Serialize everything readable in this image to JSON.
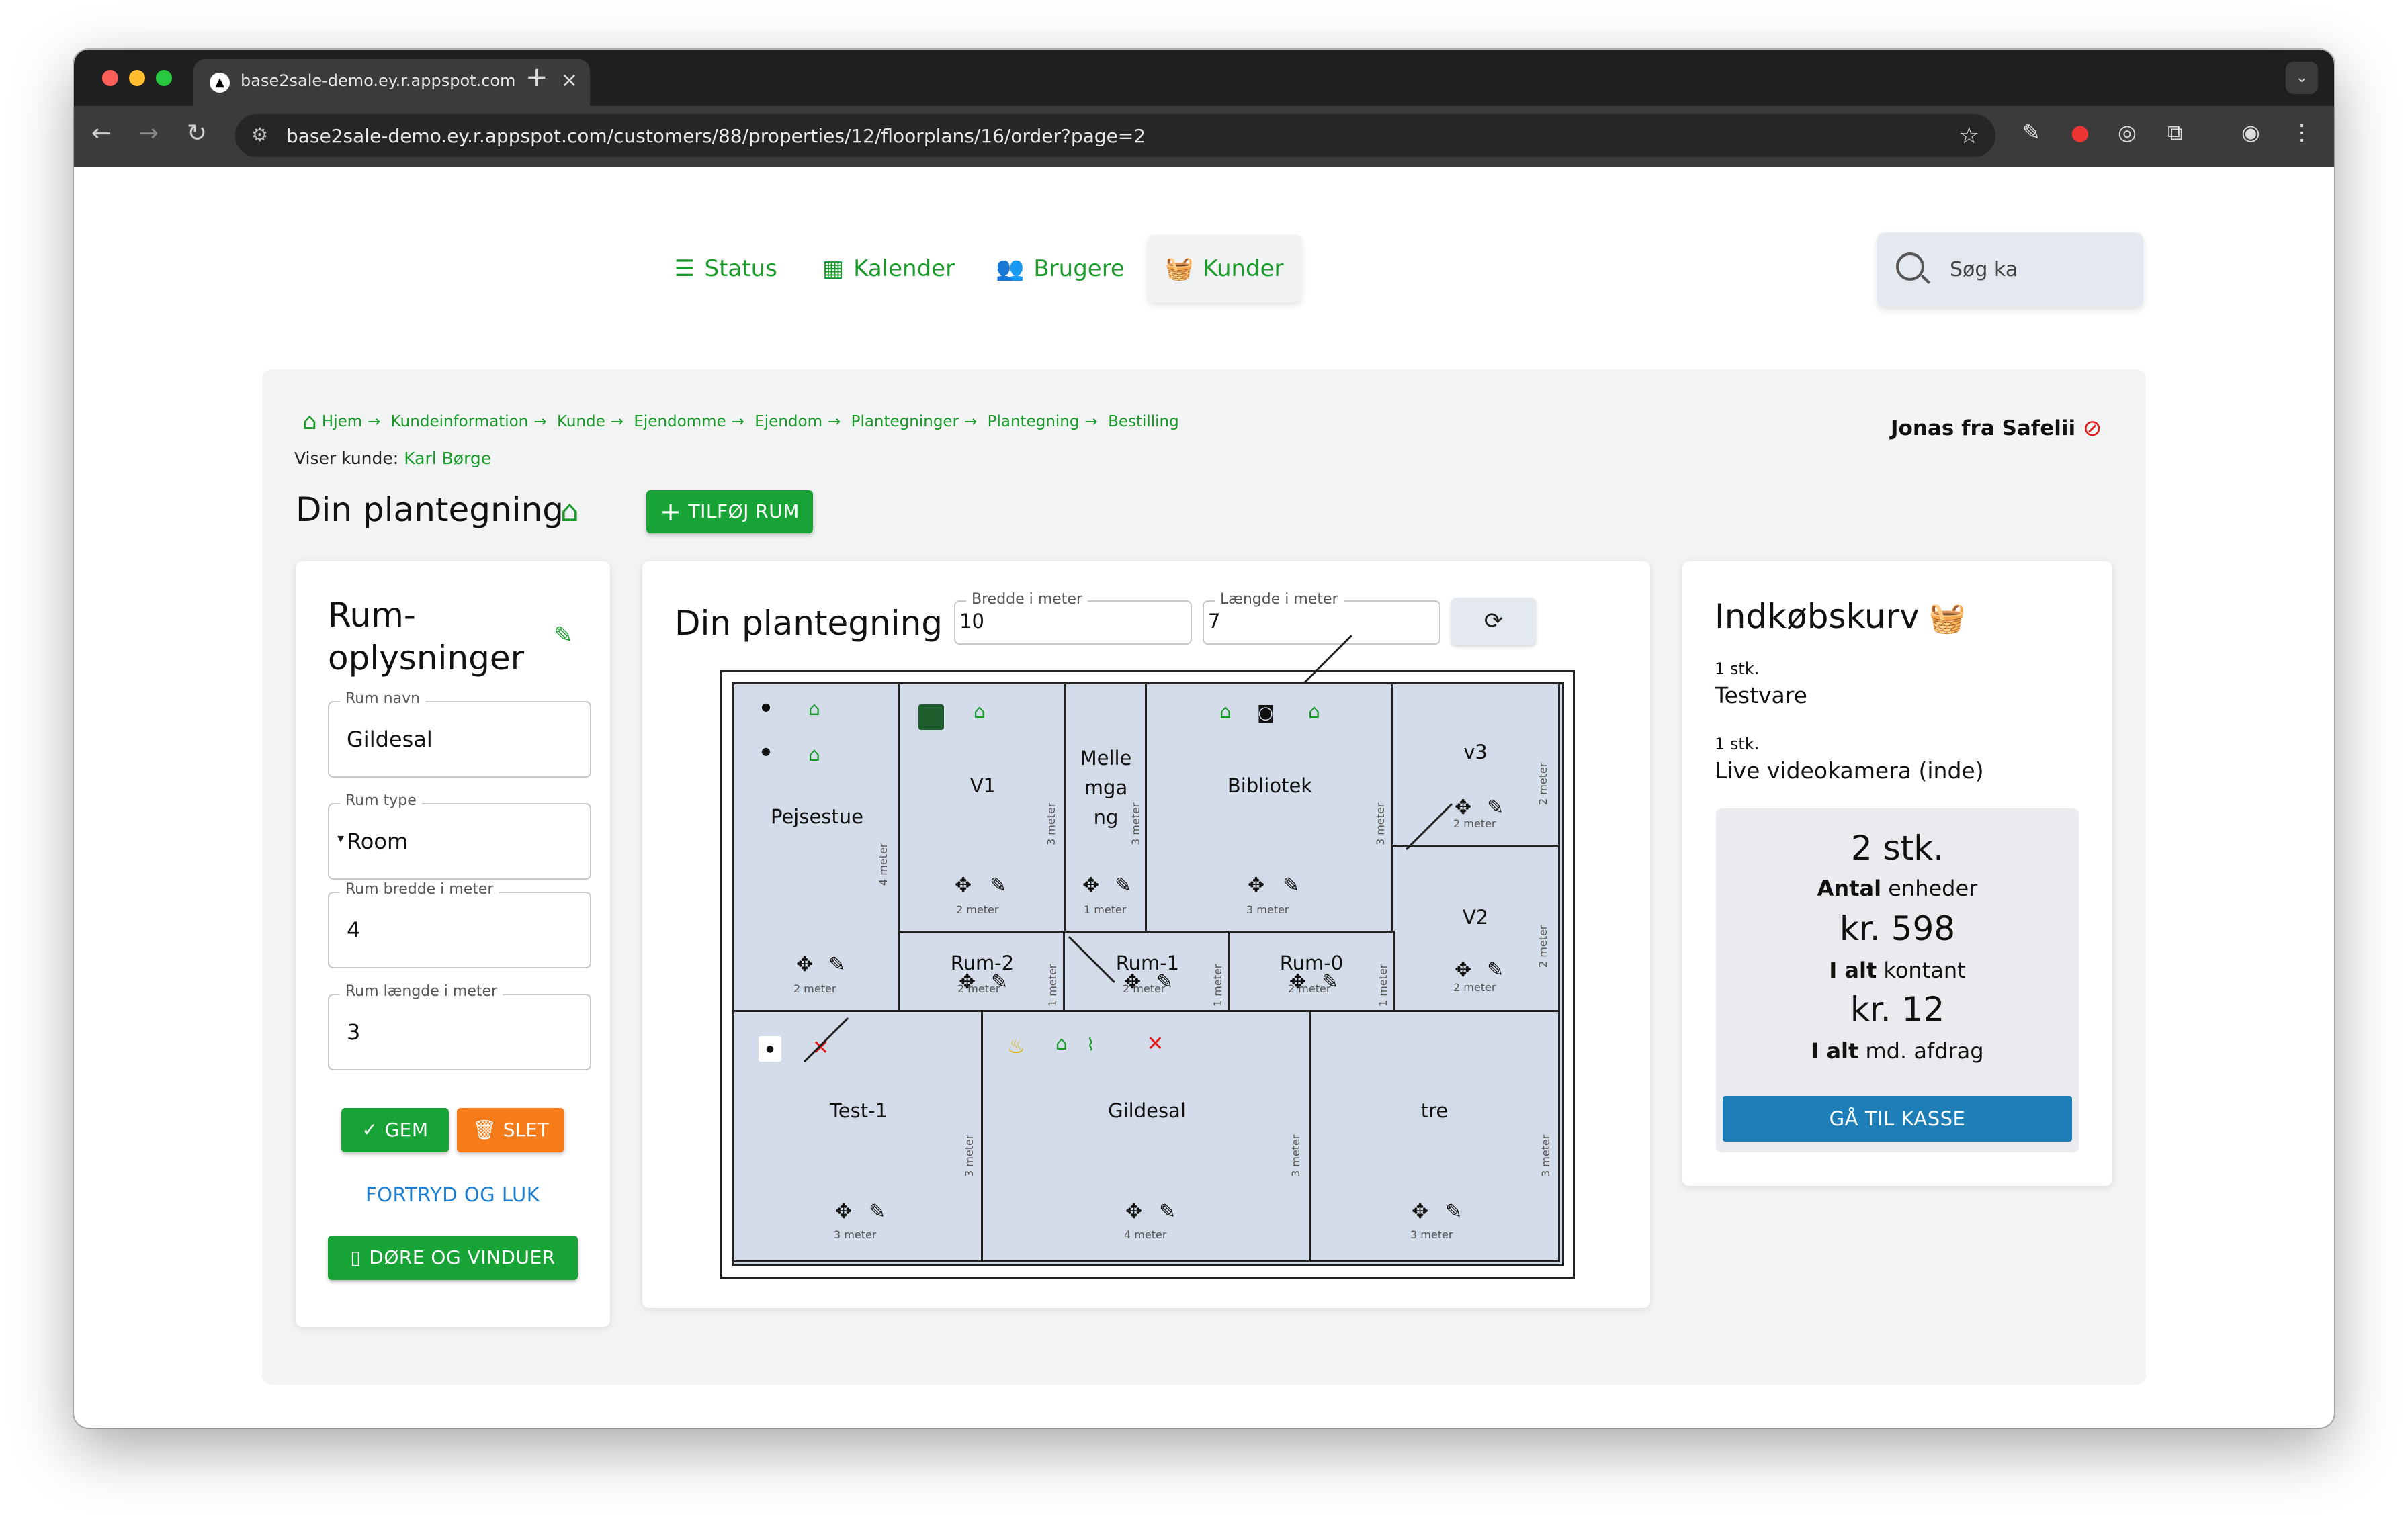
{
  "browser": {
    "tab_title": "base2sale-demo.ey.r.appspot.com",
    "tab_favicon": "▲",
    "url": "base2sale-demo.ey.r.appspot.com/customers/88/properties/12/floorplans/16/order?page=2"
  },
  "nav": {
    "items": [
      {
        "label": "Status",
        "icon": "list-check-icon"
      },
      {
        "label": "Kalender",
        "icon": "calendar-icon"
      },
      {
        "label": "Brugere",
        "icon": "users-icon"
      },
      {
        "label": "Kunder",
        "icon": "basket-icon"
      }
    ],
    "active": "Kunder",
    "search_placeholder": "Søg ka"
  },
  "breadcrumb": [
    "Hjem",
    "Kundeinformation",
    "Kunde",
    "Ejendomme",
    "Ejendom",
    "Plantegninger",
    "Plantegning",
    "Bestilling"
  ],
  "customer": {
    "prefix": "Viser kunde:",
    "name": "Karl Børge"
  },
  "user": {
    "name": "Jonas fra Safelii"
  },
  "page": {
    "title": "Din plantegning",
    "add_room_label": "TILFØJ RUM"
  },
  "room_info": {
    "title_line1": "Rum-",
    "title_line2": "oplysninger",
    "fields": [
      {
        "label": "Rum navn",
        "value": "Gildesal"
      },
      {
        "label": "Rum type",
        "value": "Room"
      },
      {
        "label": "Rum bredde i meter",
        "value": "4"
      },
      {
        "label": "Rum længde i meter",
        "value": "3"
      }
    ],
    "save_label": "GEM",
    "delete_label": "SLET",
    "cancel_label": "FORTRYD OG LUK",
    "doors_label": "DØRE OG VINDUER"
  },
  "floorplan": {
    "title": "Din plantegning",
    "width_label": "Bredde i meter",
    "width_value": "10",
    "length_label": "Længde i meter",
    "length_value": "7",
    "rooms": [
      {
        "name": "Pejsestue",
        "w": "2 meter",
        "h": "4 meter"
      },
      {
        "name": "V1",
        "w": "2 meter",
        "h": "3 meter"
      },
      {
        "name": "Melle mga ng",
        "w": "1 meter",
        "h": "3 meter"
      },
      {
        "name": "Bibliotek",
        "w": "3 meter",
        "h": "3 meter"
      },
      {
        "name": "v3",
        "w": "2 meter",
        "h": "2 meter"
      },
      {
        "name": "V2",
        "w": "2 meter",
        "h": "2 meter"
      },
      {
        "name": "Rum-2",
        "w": "2 meter",
        "h": "1 meter"
      },
      {
        "name": "Rum-1",
        "w": "2 meter",
        "h": "1 meter"
      },
      {
        "name": "Rum-0",
        "w": "2 meter",
        "h": "1 meter"
      },
      {
        "name": "Test-1",
        "w": "3 meter",
        "h": "3 meter"
      },
      {
        "name": "Gildesal",
        "w": "4 meter",
        "h": "3 meter"
      },
      {
        "name": "tre",
        "w": "3 meter",
        "h": "3 meter"
      }
    ]
  },
  "cart": {
    "title": "Indkøbskurv",
    "items": [
      {
        "qty": "1 stk.",
        "name": "Testvare"
      },
      {
        "qty": "1 stk.",
        "name": "Live videokamera (inde)"
      }
    ],
    "total_qty": "2 stk.",
    "units_bold": "Antal",
    "units_rest": "enheder",
    "total_price": "kr. 598",
    "cash_bold": "I alt",
    "cash_rest": "kontant",
    "monthly_price": "kr. 12",
    "monthly_bold": "I alt",
    "monthly_rest": "md. afdrag",
    "checkout_label": "GÅ TIL KASSE"
  }
}
